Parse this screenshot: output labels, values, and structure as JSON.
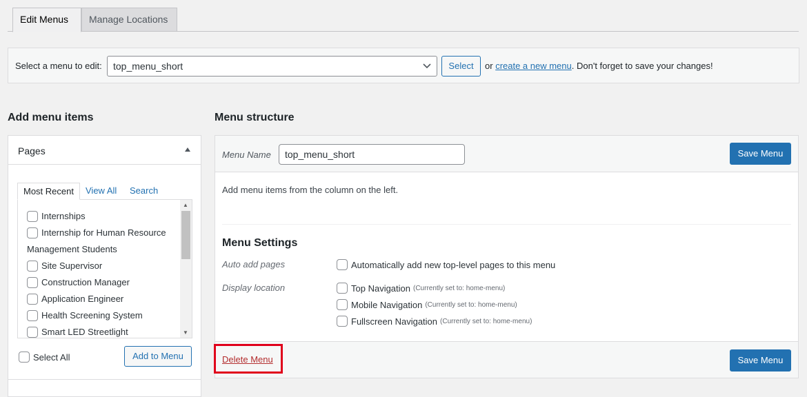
{
  "tabs": {
    "edit": "Edit Menus",
    "manage": "Manage Locations"
  },
  "select_bar": {
    "label": "Select a menu to edit:",
    "selected_menu": "top_menu_short",
    "select_button": "Select",
    "hint_prefix": "or",
    "create_link": "create a new menu",
    "hint_suffix": ". Don't forget to save your changes!"
  },
  "add_items": {
    "heading": "Add menu items",
    "section_title": "Pages",
    "inner_tabs": {
      "recent": "Most Recent",
      "all": "View All",
      "search": "Search"
    },
    "pages": [
      "Internships",
      "Internship for Human Resource Management Students",
      "Site Supervisor",
      "Construction Manager",
      "Application Engineer",
      "Health Screening System",
      "Smart LED Streetlight"
    ],
    "select_all": "Select All",
    "add_button": "Add to Menu"
  },
  "structure": {
    "heading": "Menu structure",
    "menu_name_label": "Menu Name",
    "menu_name_value": "top_menu_short",
    "save_button": "Save Menu",
    "instructions": "Add menu items from the column on the left.",
    "settings_title": "Menu Settings",
    "auto_add_label": "Auto add pages",
    "auto_add_option": "Automatically add new top-level pages to this menu",
    "display_location_label": "Display location",
    "locations": [
      {
        "name": "Top Navigation",
        "note": "(Currently set to: home-menu)"
      },
      {
        "name": "Mobile Navigation",
        "note": "(Currently set to: home-menu)"
      },
      {
        "name": "Fullscreen Navigation",
        "note": "(Currently set to: home-menu)"
      }
    ],
    "delete_link": "Delete Menu"
  },
  "colors": {
    "primary": "#2271b1",
    "delete": "#b32d2e",
    "highlight": "#e0001b"
  }
}
